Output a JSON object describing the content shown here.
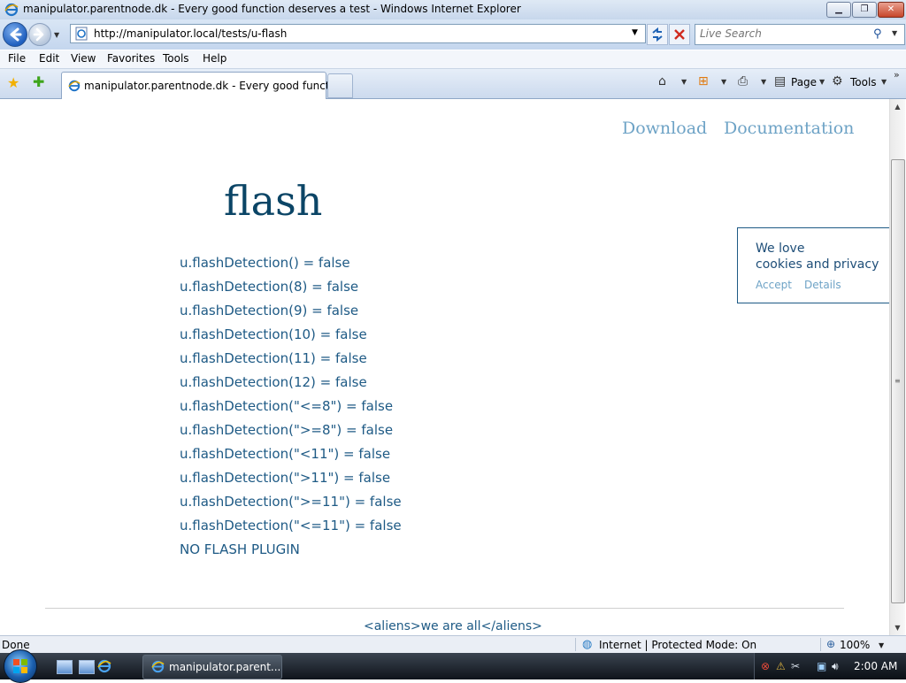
{
  "window": {
    "title": "manipulator.parentnode.dk - Every good function deserves a test - Windows Internet Explorer",
    "minimize": "▁",
    "maximize": "❐",
    "close": "✕"
  },
  "address_bar": {
    "url": "http://manipulator.local/tests/u-flash",
    "search_placeholder": "Live Search"
  },
  "menu": [
    "File",
    "Edit",
    "View",
    "Favorites",
    "Tools",
    "Help"
  ],
  "tabs": {
    "active_label": "manipulator.parentnode.dk - Every good functio..."
  },
  "toolbar": {
    "page_label": "Page",
    "tools_label": "Tools",
    "overflow": "»"
  },
  "page": {
    "nav": {
      "download": "Download",
      "documentation": "Documentation"
    },
    "title": "flash",
    "results": [
      "u.flashDetection() = false",
      "u.flashDetection(8) = false",
      "u.flashDetection(9) = false",
      "u.flashDetection(10) = false",
      "u.flashDetection(11) = false",
      "u.flashDetection(12) = false",
      "u.flashDetection(\"<=8\") = false",
      "u.flashDetection(\">=8\") = false",
      "u.flashDetection(\"<11\") = false",
      "u.flashDetection(\">11\") = false",
      "u.flashDetection(\">=11\") = false",
      "u.flashDetection(\"<=11\") = false",
      "NO FLASH PLUGIN"
    ],
    "cookie": {
      "line1": "We love",
      "line2": "cookies and privacy",
      "accept": "Accept",
      "details": "Details"
    },
    "footer": "<aliens>we are all</aliens>"
  },
  "status_bar": {
    "text": "Done",
    "zone": "Internet | Protected Mode: On",
    "zoom": "100%"
  },
  "taskbar": {
    "active_window": "manipulator.parent...",
    "clock": "2:00 AM"
  },
  "colors": {
    "title_blue": "#0b4566",
    "link_light_blue": "#6ea3c6",
    "text_blue": "#1e5a85"
  }
}
